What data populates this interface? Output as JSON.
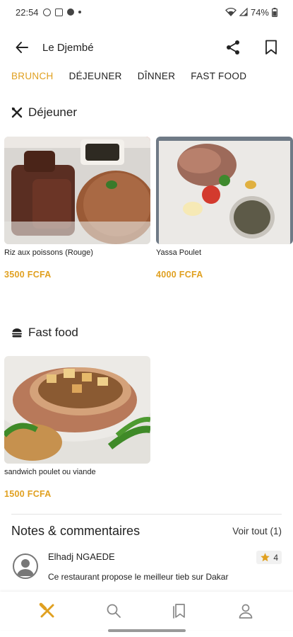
{
  "status_bar": {
    "time": "22:54",
    "battery": "74%",
    "icons": [
      "instagram-icon",
      "image-icon",
      "gear-icon",
      "dot-icon",
      "wifi-icon",
      "signal-icon",
      "battery-icon"
    ]
  },
  "app_bar": {
    "title": "Le Djembé",
    "back_icon": "arrow-left-icon",
    "share_icon": "share-icon",
    "bookmark_icon": "bookmark-icon"
  },
  "category_tabs": [
    {
      "label": "BRUNCH",
      "active": true
    },
    {
      "label": "DÉJEUNER",
      "active": false
    },
    {
      "label": "DÎNNER",
      "active": false
    },
    {
      "label": "FAST FOOD",
      "active": false
    }
  ],
  "sections": [
    {
      "title": "Déjeuner",
      "icon": "utensils-icon",
      "items": [
        {
          "name": "Riz aux poissons (Rouge)",
          "price": "3500 FCFA"
        },
        {
          "name": "Yassa Poulet",
          "price": "4000 FCFA"
        }
      ]
    },
    {
      "title": "Fast food",
      "icon": "burger-icon",
      "items": [
        {
          "name": "sandwich  poulet ou viande",
          "price": "1500 FCFA"
        }
      ]
    }
  ],
  "reviews": {
    "title": "Notes & commentaires",
    "see_all": "Voir tout (1)",
    "items": [
      {
        "author": "Elhadj NGAEDE",
        "rating": "4",
        "text": "Ce restaurant propose le meilleur tieb sur Dakar"
      }
    ]
  },
  "bottom_nav": [
    {
      "name": "restaurant",
      "icon": "utensils-icon",
      "active": true
    },
    {
      "name": "search",
      "icon": "search-icon",
      "active": false
    },
    {
      "name": "bookmarks",
      "icon": "bookmark-icon",
      "active": false
    },
    {
      "name": "profile",
      "icon": "user-icon",
      "active": false
    }
  ],
  "colors": {
    "accent": "#e0a020",
    "text": "#222222",
    "divider": "#e4e4e4"
  }
}
